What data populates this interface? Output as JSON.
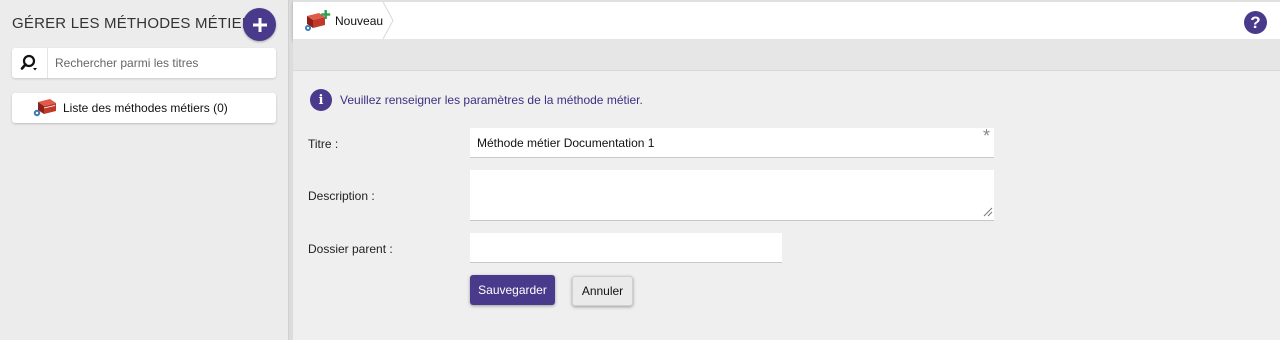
{
  "sidebar": {
    "title": "GÉRER LES MÉTHODES MÉTIER",
    "add_button_icon": "plus-icon",
    "search": {
      "placeholder": "Rechercher parmi les titres",
      "value": ""
    },
    "list_item": {
      "label": "Liste des méthodes métiers (0)",
      "icon": "book-gear-icon"
    }
  },
  "tabbar": {
    "tab_label": "Nouveau",
    "tab_icon": "book-add-icon",
    "help_icon_glyph": "?"
  },
  "form": {
    "info_text": "Veuillez renseigner les paramètres de la méthode métier.",
    "info_glyph": "i",
    "title_label": "Titre :",
    "title_value": "Méthode métier Documentation 1",
    "required_mark": "*",
    "description_label": "Description :",
    "description_value": "",
    "parent_label": "Dossier parent :",
    "parent_value": "",
    "save_label": "Sauvegarder",
    "cancel_label": "Annuler"
  },
  "colors": {
    "accent": "#4a3a8c",
    "info_text": "#3d2f82",
    "book_red": "#c0392b"
  }
}
